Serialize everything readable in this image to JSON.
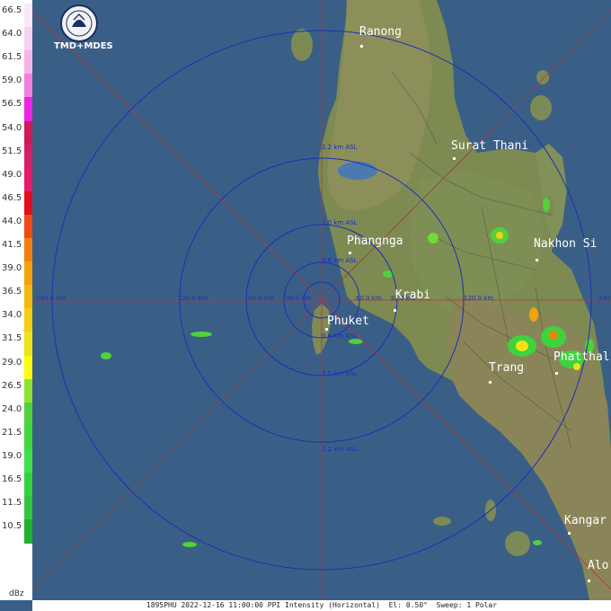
{
  "legend": {
    "unit": "dBz",
    "levels": [
      {
        "label": "66.5",
        "color": "#fbe8f6"
      },
      {
        "label": "64.0",
        "color": "#f7d2ef"
      },
      {
        "label": "61.5",
        "color": "#f5b4e8"
      },
      {
        "label": "59.0",
        "color": "#f27fe0"
      },
      {
        "label": "56.5",
        "color": "#ee22e4"
      },
      {
        "label": "54.0",
        "color": "#cc1a5a"
      },
      {
        "label": "51.5",
        "color": "#d81e63"
      },
      {
        "label": "49.0",
        "color": "#e81a6a"
      },
      {
        "label": "46.5",
        "color": "#e20e1c"
      },
      {
        "label": "44.0",
        "color": "#f04a10"
      },
      {
        "label": "41.5",
        "color": "#f3800c"
      },
      {
        "label": "39.0",
        "color": "#f3a20c"
      },
      {
        "label": "36.5",
        "color": "#f5b80f"
      },
      {
        "label": "34.0",
        "color": "#f5cf12"
      },
      {
        "label": "31.5",
        "color": "#eee317"
      },
      {
        "label": "29.0",
        "color": "#fcfb0a"
      },
      {
        "label": "26.5",
        "color": "#8ce233"
      },
      {
        "label": "24.0",
        "color": "#4fd23a"
      },
      {
        "label": "21.5",
        "color": "#3fd83f"
      },
      {
        "label": "19.0",
        "color": "#3ee04a"
      },
      {
        "label": "16.5",
        "color": "#34d240"
      },
      {
        "label": "11.5",
        "color": "#30c83a"
      },
      {
        "label": "10.5",
        "color": "#1fb02f"
      }
    ]
  },
  "logo": {
    "text": "TMD+MDES",
    "icon": "tmd-seal-icon"
  },
  "cities": [
    {
      "name": "Ranong"
    },
    {
      "name": "Surat Thani"
    },
    {
      "name": "Phangnga"
    },
    {
      "name": "Nakhon Si"
    },
    {
      "name": "Krabi"
    },
    {
      "name": "Phuket"
    },
    {
      "name": "Trang"
    },
    {
      "name": "Phatthal"
    },
    {
      "name": "Kangar"
    },
    {
      "name": "Alo"
    }
  ],
  "ring_labels": {
    "r240_left": "240.0 km",
    "r240_right": "240",
    "r120_left": "120.0 km",
    "r120_right": "120.0 km",
    "r60_left": "60.0 km",
    "r60_right": "60.0 km",
    "r30_left": "30.0 km",
    "r30_right": "30.0 km"
  },
  "height_labels": {
    "h1": "2.2 km ASL",
    "h2": "1.0 km ASL",
    "h3": "0.6 km ASL",
    "h4": "0.6 km ASL",
    "h5": "1.0 km ASL",
    "h6": "2.2 km ASL"
  },
  "footer": {
    "text": "1895PHU 2022-12-16 11:00:00 PPI Intensity (Horizontal)  El: 0.50°  Sweep: 1 Polar"
  },
  "colors": {
    "sea": "#3a5f86",
    "land": "#8a8a5a",
    "range_ring": "#1c2fb8",
    "crosshair": "#b8343a"
  }
}
